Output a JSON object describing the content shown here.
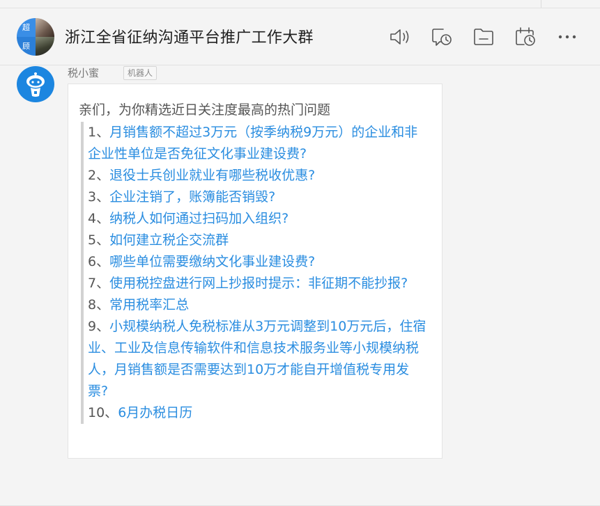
{
  "header": {
    "group_title": "浙江全省征纳沟通平台推广工作大群",
    "avatar_text_top": "超",
    "avatar_text_bottom": "顾",
    "icons": [
      "voice-call-icon",
      "history-message-icon",
      "file-icon",
      "schedule-icon",
      "more-icon"
    ]
  },
  "message": {
    "sender": "税小蜜",
    "badge": "机器人",
    "intro": "亲们，为你精选近日关注度最高的热门问题",
    "questions": [
      {
        "num": "1、",
        "text": "月销售额不超过3万元（按季纳税9万元）的企业和非企业性单位是否免征文化事业建设费?"
      },
      {
        "num": "2、",
        "text": "退役士兵创业就业有哪些税收优惠?"
      },
      {
        "num": "3、",
        "text": "企业注销了，账簿能否销毁?"
      },
      {
        "num": "4、",
        "text": "纳税人如何通过扫码加入组织?"
      },
      {
        "num": "5、",
        "text": "如何建立税企交流群"
      },
      {
        "num": "6、",
        "text": "哪些单位需要缴纳文化事业建设费?"
      },
      {
        "num": "7、",
        "text": "使用税控盘进行网上抄报时提示：非征期不能抄报?"
      },
      {
        "num": "8、",
        "text": "常用税率汇总"
      },
      {
        "num": "9、",
        "text": "小规模纳税人免税标准从3万元调整到10万元后，住宿业、工业及信息传输软件和信息技术服务业等小规模纳税人，月销售额是否需要达到10万才能自开增值税专用发票?"
      },
      {
        "num": "10、",
        "text": "6月办税日历"
      }
    ]
  },
  "colors": {
    "link": "#2a8de0",
    "bot_avatar": "#1c86e0",
    "text_muted": "#555555"
  }
}
